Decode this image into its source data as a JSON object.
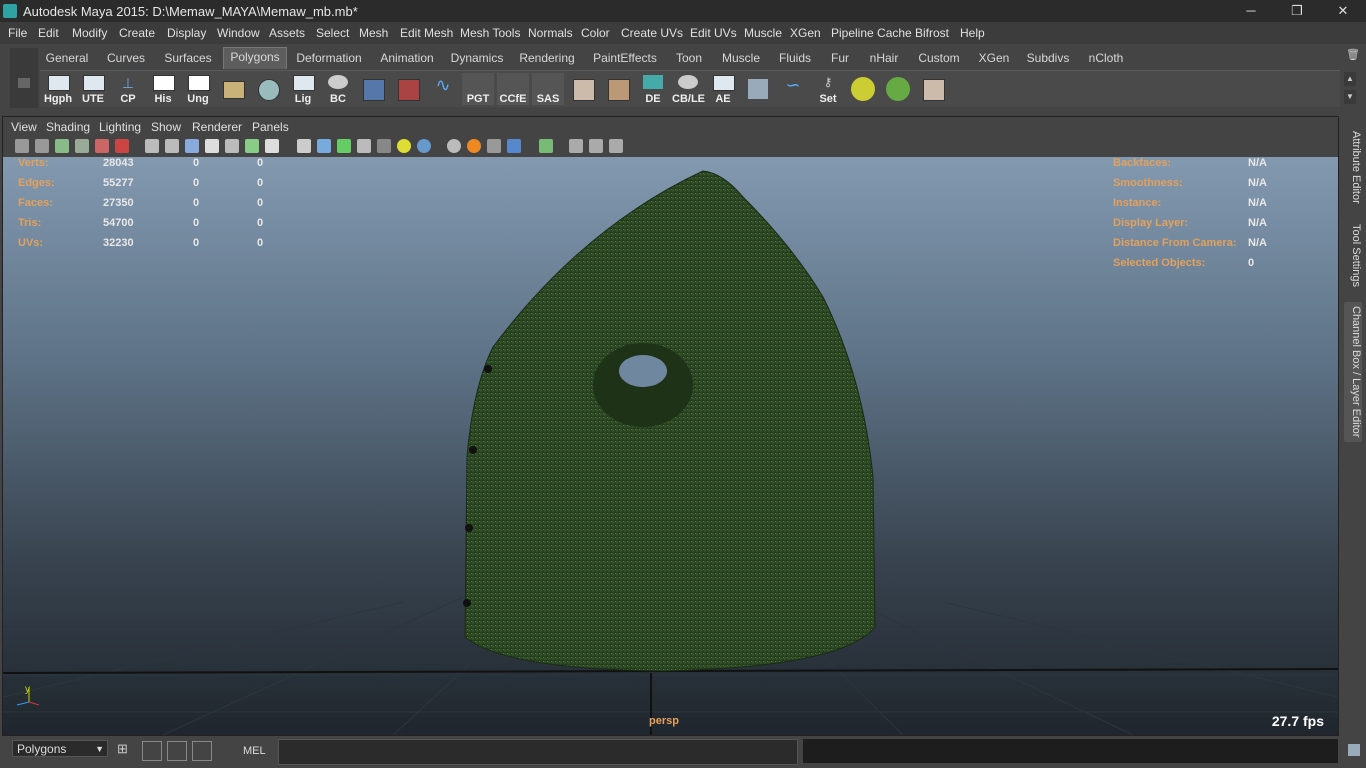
{
  "titlebar": {
    "title": "Autodesk Maya 2015: D:\\Memaw_MAYA\\Memaw_mb.mb*",
    "min": "─",
    "restore": "❐",
    "close": "✕"
  },
  "menubar": [
    "File",
    "Edit",
    "Modify",
    "Create",
    "Display",
    "Window",
    "Assets",
    "Select",
    "Mesh",
    "Edit Mesh",
    "Mesh Tools",
    "Normals",
    "Color",
    "Create UVs",
    "Edit UVs",
    "Muscle",
    "XGen",
    "Pipeline Cache",
    "Bifrost",
    "Help"
  ],
  "shelf_tabs": {
    "items": [
      "General",
      "Curves",
      "Surfaces",
      "Polygons",
      "Deformation",
      "Animation",
      "Dynamics",
      "Rendering",
      "PaintEffects",
      "Toon",
      "Muscle",
      "Fluids",
      "Fur",
      "nHair",
      "Custom",
      "XGen",
      "Subdivs",
      "nCloth"
    ],
    "active": "Polygons"
  },
  "shelf_buttons": [
    "Hgph",
    "UTE",
    "CP",
    "His",
    "Ung",
    "",
    "",
    "Lig",
    "BC",
    "",
    "",
    "",
    "PGT",
    "CCfE",
    "SAS",
    "",
    "",
    "DE",
    "CB/LE",
    "AE",
    "",
    "",
    "Set",
    "",
    ""
  ],
  "panel_menu": [
    "View",
    "Shading",
    "Lighting",
    "Show",
    "Renderer",
    "Panels"
  ],
  "hud_left": {
    "rows": [
      {
        "label": "Verts:",
        "values": [
          "28043",
          "0",
          "0"
        ]
      },
      {
        "label": "Edges:",
        "values": [
          "55277",
          "0",
          "0"
        ]
      },
      {
        "label": "Faces:",
        "values": [
          "27350",
          "0",
          "0"
        ]
      },
      {
        "label": "Tris:",
        "values": [
          "54700",
          "0",
          "0"
        ]
      },
      {
        "label": "UVs:",
        "values": [
          "32230",
          "0",
          "0"
        ]
      }
    ]
  },
  "hud_right": {
    "rows": [
      {
        "label": "Backfaces:",
        "value": "N/A"
      },
      {
        "label": "Smoothness:",
        "value": "N/A"
      },
      {
        "label": "Instance:",
        "value": "N/A"
      },
      {
        "label": "Display Layer:",
        "value": "N/A"
      },
      {
        "label": "Distance From Camera:",
        "value": "N/A"
      },
      {
        "label": "Selected Objects:",
        "value": "0"
      }
    ]
  },
  "viewport": {
    "camera": "persp",
    "fps": "27.7 fps",
    "axis_y": "y"
  },
  "right_dock_tabs": [
    "Attribute Editor",
    "Tool Settings",
    "Channel Box / Layer Editor"
  ],
  "bottombar": {
    "mode": "Polygons",
    "mel_label": "MEL"
  },
  "colors": {
    "hud_label": "#e3a15c",
    "model": "#2e4a26"
  }
}
